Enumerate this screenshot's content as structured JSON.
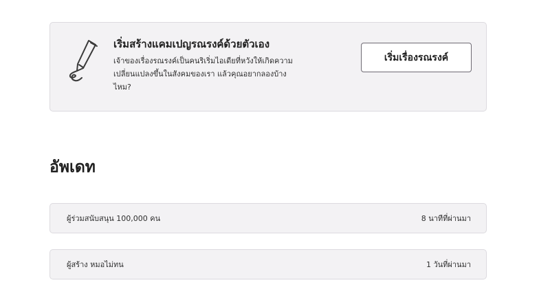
{
  "promo": {
    "icon": "pen-icon",
    "title": "เริ่มสร้างแคมเปญรณรงค์ด้วยตัวเอง",
    "description_line1": "เจ้าของเรื่องรณรงค์เป็นคนริเริ่มไอเดียที่หวังให้เกิดความ",
    "description_line2": "เปลี่ยนแปลงขึ้นในสังคมของเรา แล้วคุณอยากลองบ้าง",
    "description_line3": "ไหม?",
    "button_label": "เริ่มเรื่องรณรงค์"
  },
  "updates": {
    "heading": "อัพเดท",
    "items": [
      {
        "text": "ผู้ร่วมสนับสนุน 100,000 คน",
        "time": "8 นาทีที่ผ่านมา"
      },
      {
        "text": "ผู้สร้าง หมอไม่ทน",
        "time": "1 วันที่ผ่านมา"
      }
    ]
  }
}
